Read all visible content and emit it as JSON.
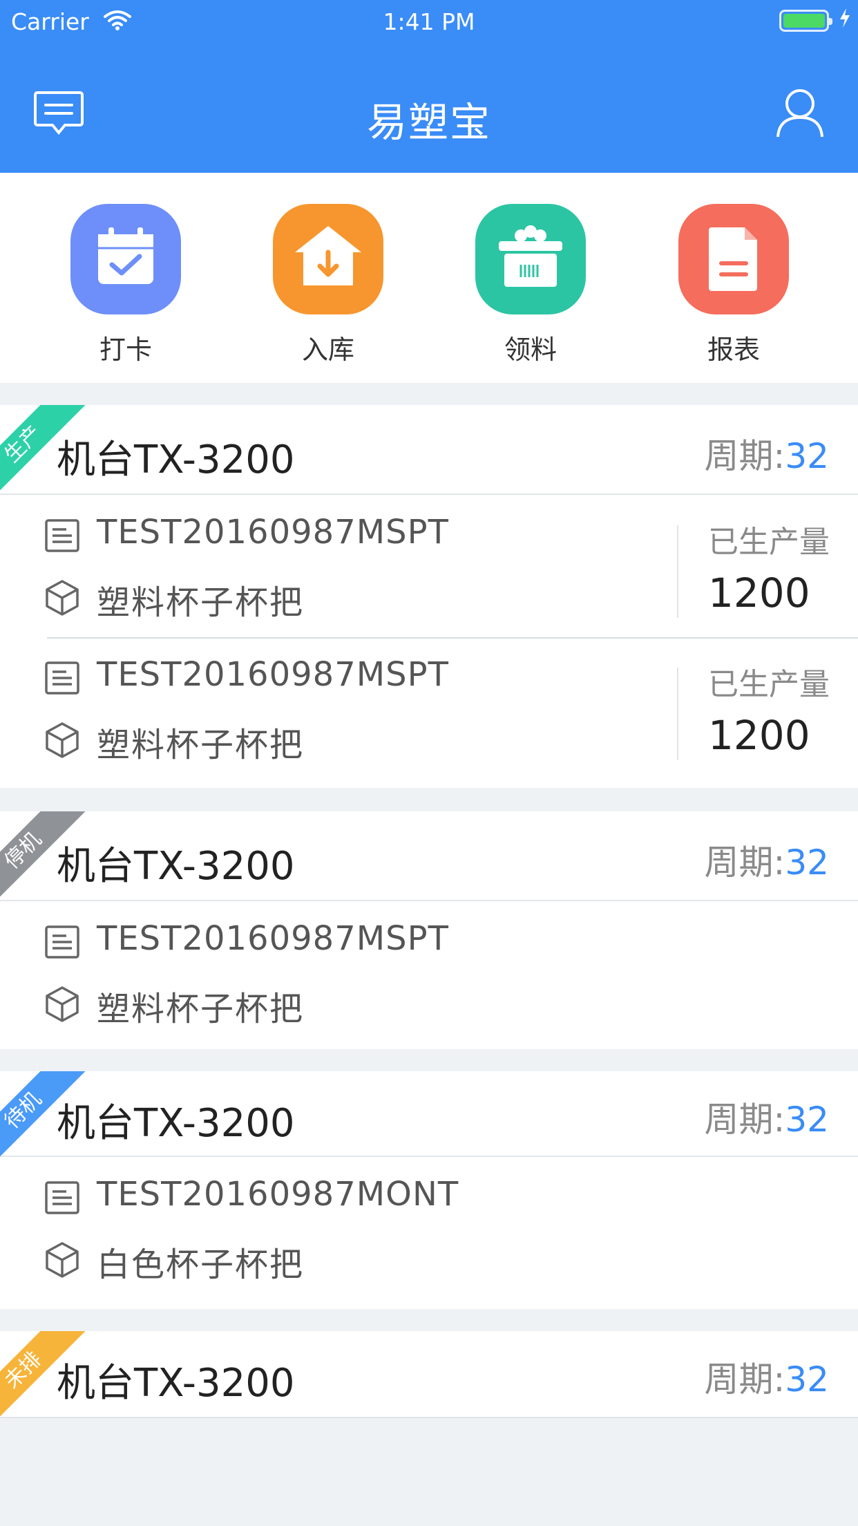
{
  "status_bar": {
    "carrier": "Carrier",
    "time": "1:41 PM"
  },
  "nav": {
    "title": "易塑宝",
    "message_icon": "message-icon",
    "user_icon": "user-icon"
  },
  "quick_actions": [
    {
      "label": "打卡",
      "icon": "calendar-check-icon",
      "color": "#6e8ff9"
    },
    {
      "label": "入库",
      "icon": "warehouse-in-icon",
      "color": "#f7962e"
    },
    {
      "label": "领料",
      "icon": "material-box-icon",
      "color": "#2cc5a3"
    },
    {
      "label": "报表",
      "icon": "report-icon",
      "color": "#f56d5c"
    }
  ],
  "cycle_label": "周期:",
  "machines": [
    {
      "status": "生产",
      "status_color": "#2dd1a8",
      "name": "机台TX-3200",
      "cycle": "32",
      "orders": [
        {
          "code": "TEST20160987MSPT",
          "product": "塑料杯子杯把",
          "qty_label": "已生产量",
          "qty": "1200"
        },
        {
          "code": "TEST20160987MSPT",
          "product": "塑料杯子杯把",
          "qty_label": "已生产量",
          "qty": "1200"
        }
      ]
    },
    {
      "status": "停机",
      "status_color": "#8f9398",
      "name": "机台TX-3200",
      "cycle": "32",
      "orders": [
        {
          "code": "TEST20160987MSPT",
          "product": "塑料杯子杯把"
        }
      ]
    },
    {
      "status": "待机",
      "status_color": "#4a9af8",
      "name": "机台TX-3200",
      "cycle": "32",
      "orders": [
        {
          "code": "TEST20160987MONT",
          "product": "白色杯子杯把"
        }
      ]
    },
    {
      "status": "未排",
      "status_color": "#f6b43a",
      "name": "机台TX-3200",
      "cycle": "32",
      "orders": []
    }
  ]
}
